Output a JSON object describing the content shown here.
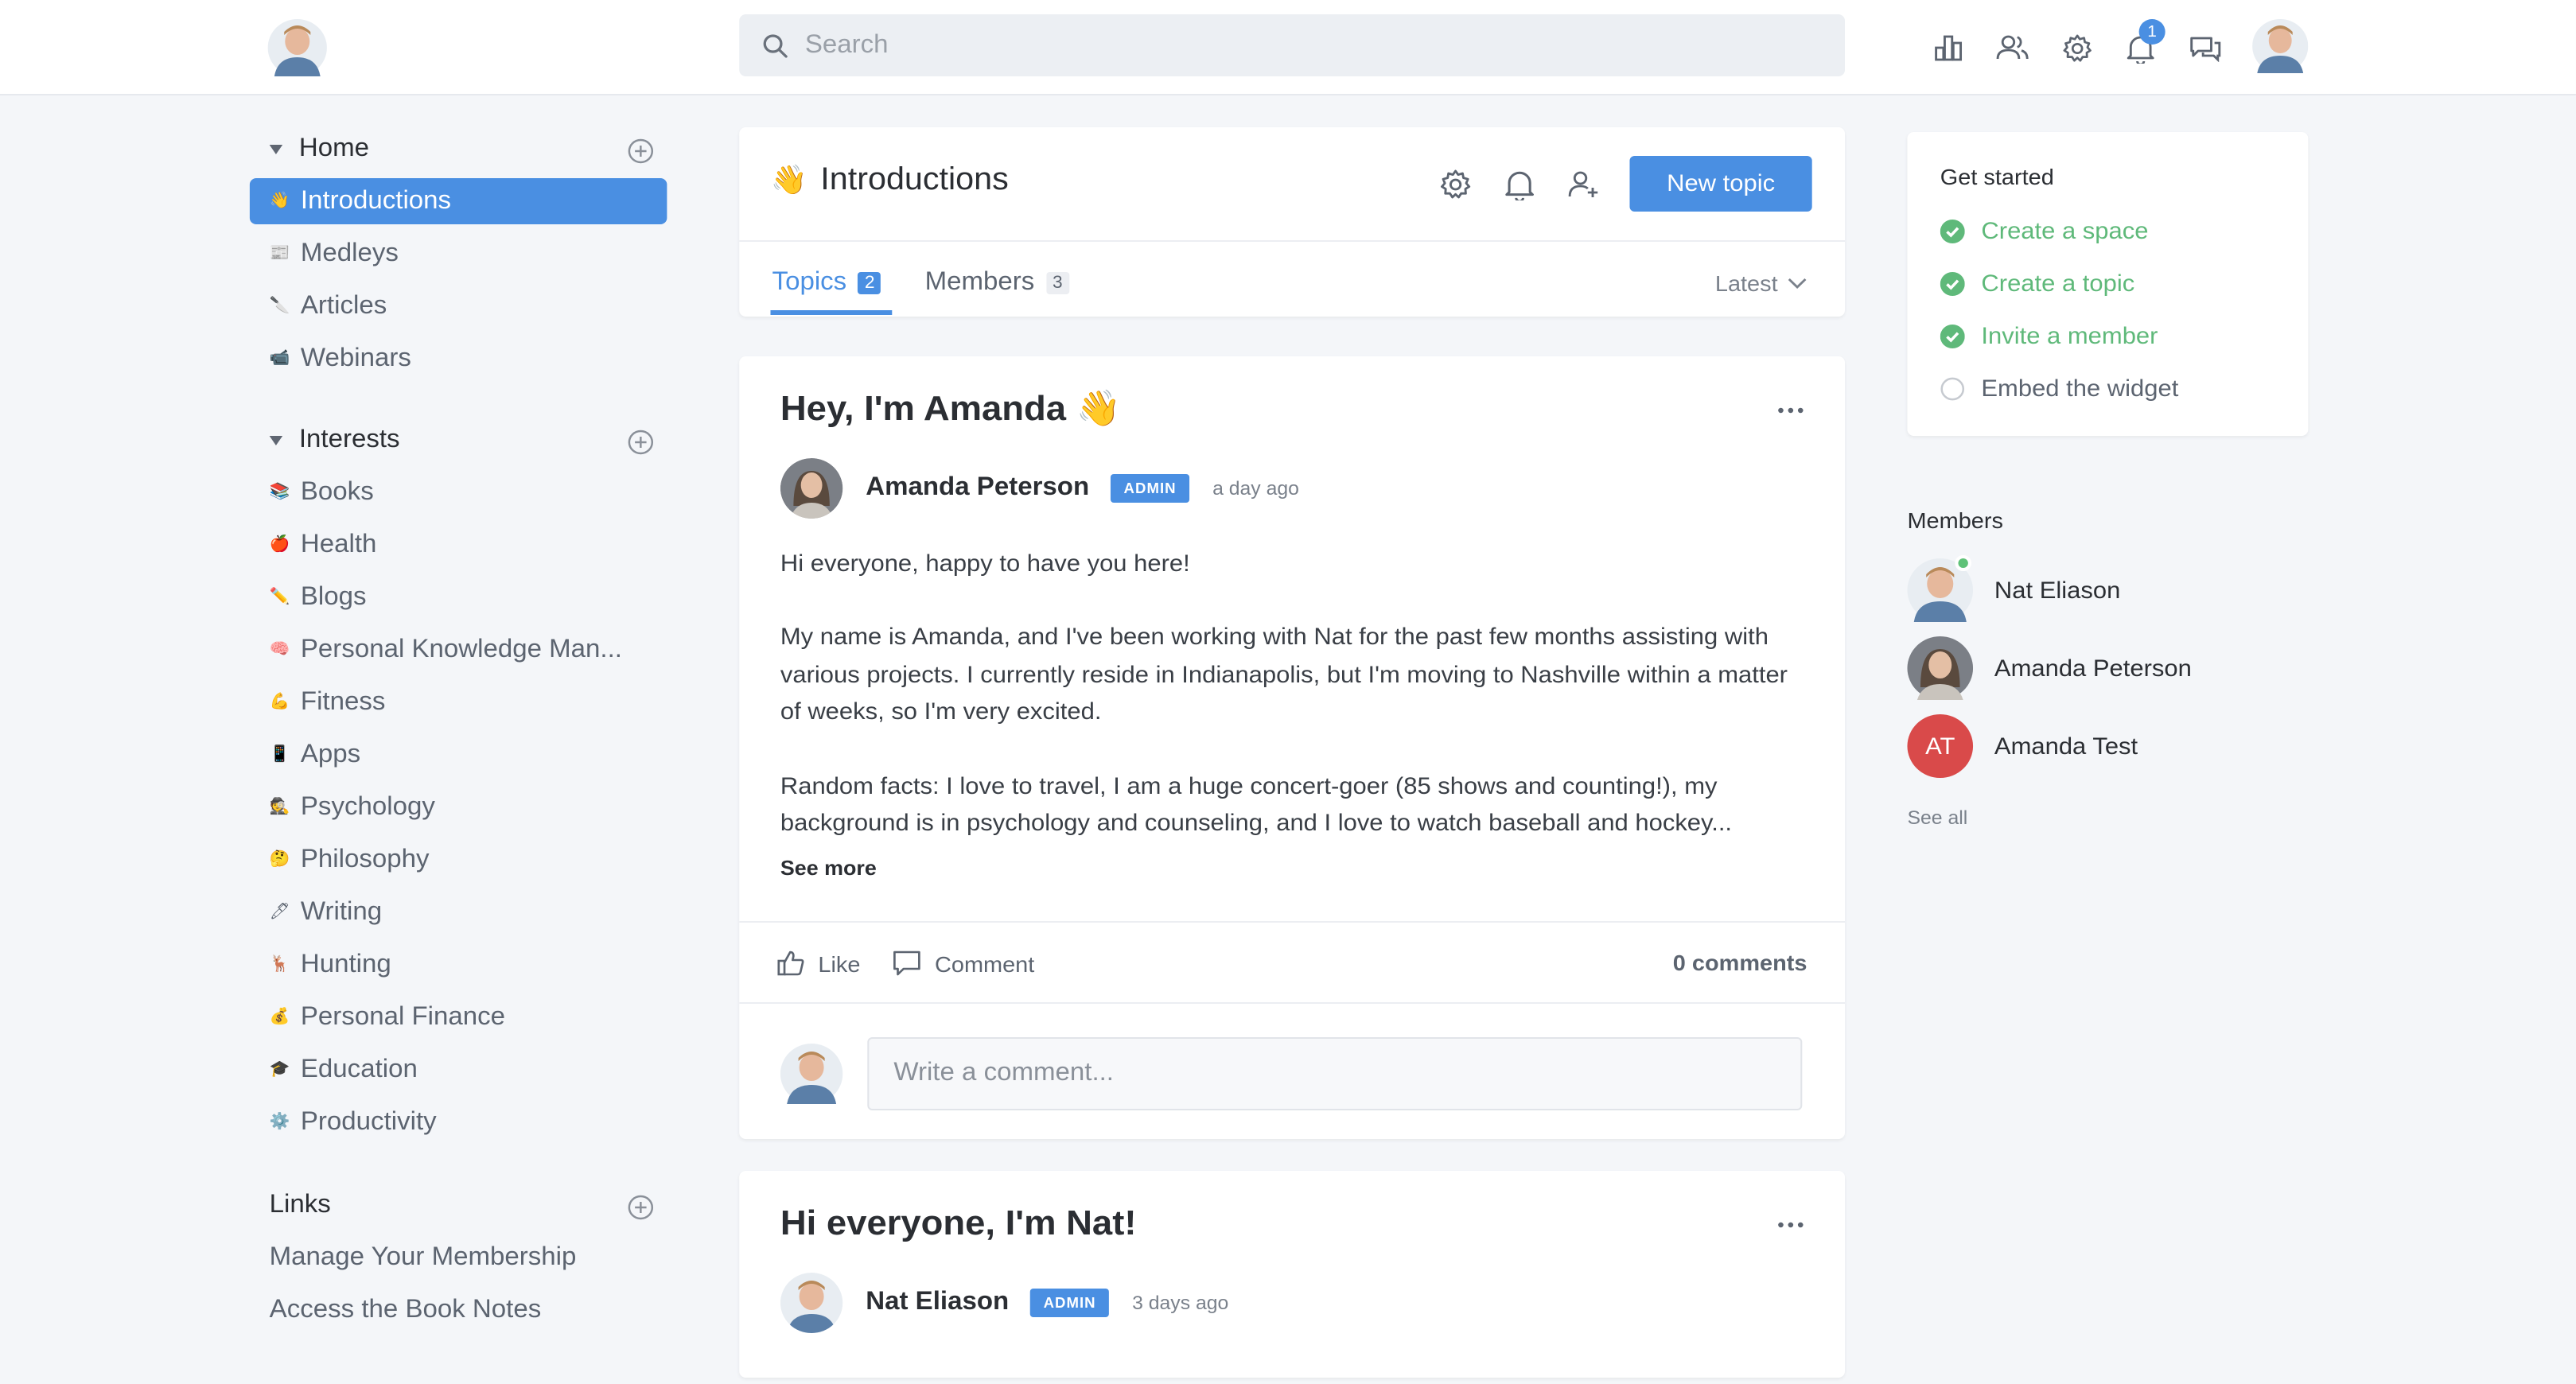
{
  "search": {
    "placeholder": "Search"
  },
  "notifications": {
    "count": "1"
  },
  "sidebar": {
    "home": {
      "title": "Home",
      "items": [
        {
          "emoji": "👋",
          "label": "Introductions"
        },
        {
          "emoji": "📰",
          "label": "Medleys"
        },
        {
          "emoji": "🔪",
          "label": "Articles"
        },
        {
          "emoji": "📹",
          "label": "Webinars"
        }
      ]
    },
    "interests": {
      "title": "Interests",
      "items": [
        {
          "emoji": "📚",
          "label": "Books"
        },
        {
          "emoji": "🍎",
          "label": "Health"
        },
        {
          "emoji": "✏️",
          "label": "Blogs"
        },
        {
          "emoji": "🧠",
          "label": "Personal Knowledge Man..."
        },
        {
          "emoji": "💪",
          "label": "Fitness"
        },
        {
          "emoji": "📱",
          "label": "Apps"
        },
        {
          "emoji": "🕵",
          "label": "Psychology"
        },
        {
          "emoji": "🤔",
          "label": "Philosophy"
        },
        {
          "emoji": "🖊",
          "label": "Writing"
        },
        {
          "emoji": "🦌",
          "label": "Hunting"
        },
        {
          "emoji": "💰",
          "label": "Personal Finance"
        },
        {
          "emoji": "🎓",
          "label": "Education"
        },
        {
          "emoji": "⚙️",
          "label": "Productivity"
        }
      ]
    },
    "links": {
      "title": "Links",
      "items": [
        {
          "label": "Manage Your Membership"
        },
        {
          "label": "Access the Book Notes"
        }
      ]
    }
  },
  "space": {
    "emoji": "👋",
    "title": "Introductions",
    "new_topic": "New topic",
    "tabs": [
      {
        "label": "Topics",
        "count": "2"
      },
      {
        "label": "Members",
        "count": "3"
      }
    ],
    "sort": "Latest"
  },
  "posts": [
    {
      "title": "Hey, I'm Amanda 👋",
      "author": "Amanda Peterson",
      "badge": "ADMIN",
      "time": "a day ago",
      "body": [
        "Hi everyone, happy to have you here!",
        "My name is Amanda, and I've been working with Nat for the past few months assisting with various projects. I currently reside in Indianapolis, but I'm moving to Nashville within a matter of weeks, so I'm very excited.",
        "Random facts: I love to travel, I am a huge concert-goer (85 shows and counting!), my background is in psychology and counseling, and I love to watch baseball and hockey..."
      ],
      "see_more": "See more",
      "like": "Like",
      "comment": "Comment",
      "comment_count": "0 comments",
      "comment_placeholder": "Write a comment..."
    },
    {
      "title": "Hi everyone, I'm Nat!",
      "author": "Nat Eliason",
      "badge": "ADMIN",
      "time": "3 days ago"
    }
  ],
  "get_started": {
    "title": "Get started",
    "items": [
      {
        "label": "Create a space",
        "done": true
      },
      {
        "label": "Create a topic",
        "done": true
      },
      {
        "label": "Invite a member",
        "done": true
      },
      {
        "label": "Embed the widget",
        "done": false
      }
    ]
  },
  "members": {
    "title": "Members",
    "list": [
      {
        "name": "Nat Eliason"
      },
      {
        "name": "Amanda Peterson"
      },
      {
        "name": "Amanda Test",
        "initials": "AT"
      }
    ],
    "see_all": "See all"
  },
  "colors": {
    "accent": "#4a8fe2",
    "success": "#5fb97a",
    "avatar_at": "#d94a4a"
  }
}
